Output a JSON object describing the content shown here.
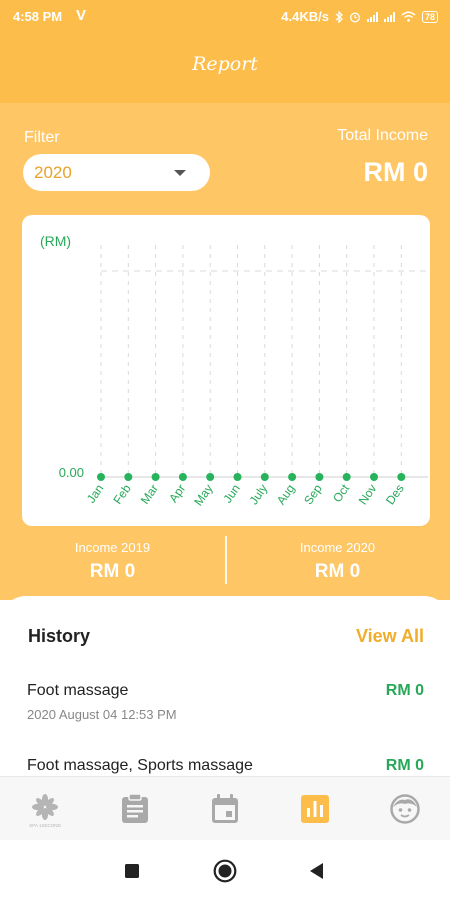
{
  "status_bar": {
    "time": "4:58 PM",
    "carrier_icon": "V",
    "network_speed": "4.4KB/s",
    "icons": [
      "bluetooth-icon",
      "alarm-icon",
      "signal-icon",
      "signal-icon",
      "wifi-icon"
    ],
    "battery": "78"
  },
  "header": {
    "title": "Report"
  },
  "filter": {
    "label": "Filter",
    "selected": "2020"
  },
  "total_income": {
    "label": "Total Income",
    "value": "RM 0"
  },
  "chart_data": {
    "type": "line",
    "ylabel": "(RM)",
    "categories": [
      "Jan",
      "Feb",
      "Mar",
      "Apr",
      "May",
      "Jun",
      "July",
      "Aug",
      "Sep",
      "Oct",
      "Nov",
      "Des"
    ],
    "ytick_labels": [
      "0.00"
    ],
    "series": [
      {
        "values": [
          0,
          0,
          0,
          0,
          0,
          0,
          0,
          0,
          0,
          0,
          0,
          0
        ]
      }
    ],
    "ylim": [
      0,
      1
    ],
    "grid": true,
    "colors": {
      "point": "#27b35c",
      "label": "#27a859"
    }
  },
  "income_summary": [
    {
      "label": "Income 2019",
      "value": "RM 0"
    },
    {
      "label": "Income 2020",
      "value": "RM 0"
    }
  ],
  "history": {
    "title": "History",
    "view_all": "View All",
    "items": [
      {
        "name": "Foot massage",
        "date": "2020 August 04 12:53 PM",
        "amount": "RM 0"
      },
      {
        "name": "Foot massage, Sports massage",
        "amount": "RM 0"
      }
    ]
  },
  "bottom_nav": {
    "logo_text": "SPA 1SECOND",
    "items": [
      "home-logo-icon",
      "clipboard-icon",
      "calendar-icon",
      "report-chart-icon",
      "profile-face-icon"
    ],
    "active_index": 3,
    "colors": {
      "active": "#fdbd4a",
      "inactive": "#a9a9a9"
    }
  },
  "system_nav": [
    "recents-square-icon",
    "home-circle-icon",
    "back-triangle-icon"
  ]
}
